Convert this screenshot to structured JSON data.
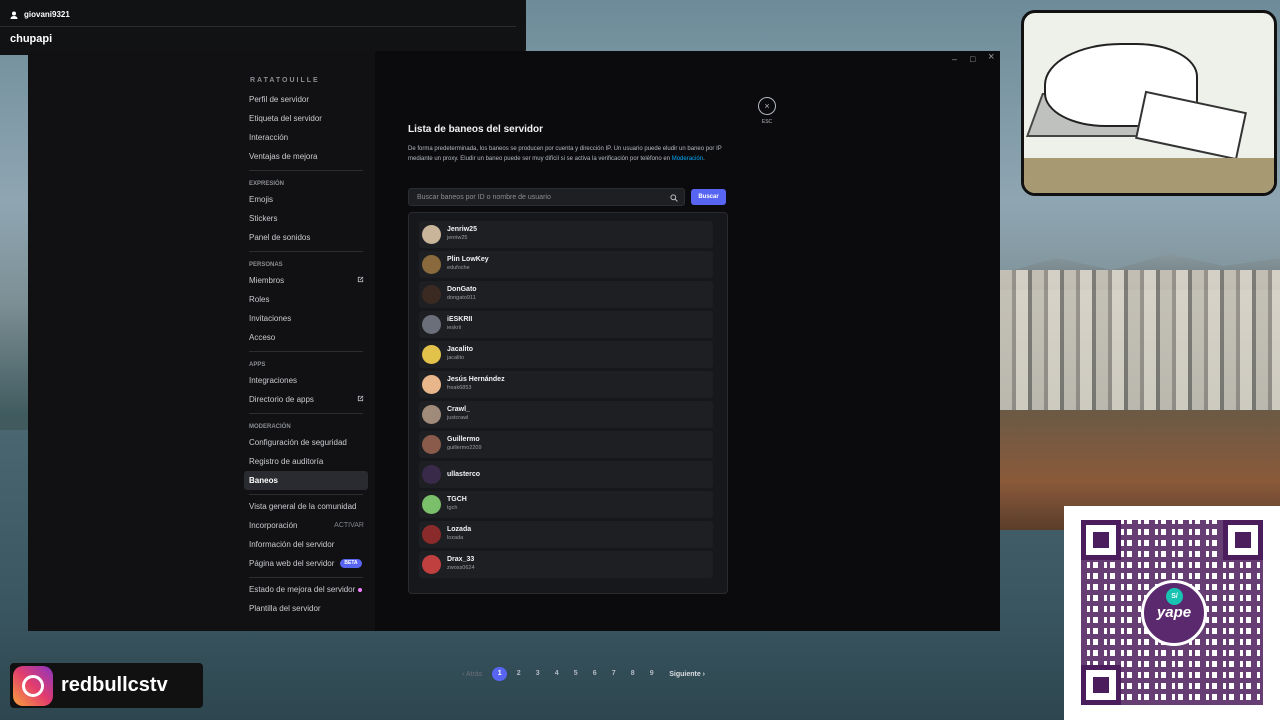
{
  "popup": {
    "username": "giovani9321",
    "name": "chupapi"
  },
  "window": {
    "min": "–",
    "max": "□",
    "close": "×"
  },
  "sidebar": {
    "server_name": "RATATOUILLE",
    "group1": [
      "Perfil de servidor",
      "Etiqueta del servidor",
      "Interacción",
      "Ventajas de mejora"
    ],
    "cat_expresion": "EXPRESIÓN",
    "group2": [
      "Emojis",
      "Stickers",
      "Panel de sonidos"
    ],
    "cat_personas": "PERSONAS",
    "group3": [
      "Miembros",
      "Roles",
      "Invitaciones",
      "Acceso"
    ],
    "cat_apps": "APPS",
    "group4": [
      "Integraciones",
      "Directorio de apps"
    ],
    "cat_moderacion": "MODERACIÓN",
    "group5": [
      "Configuración de seguridad",
      "Registro de auditoría",
      "Baneos"
    ],
    "group6": [
      "Vista general de la comunidad",
      "Incorporación",
      "Información del servidor",
      "Página web del servidor"
    ],
    "activar": "ACTIVAR",
    "beta": "BETA",
    "group7": [
      "Estado de mejora del servidor",
      "Plantilla del servidor"
    ]
  },
  "main": {
    "title": "Lista de baneos del servidor",
    "desc": "De forma predeterminada, los baneos se producen por cuenta y dirección IP. Un usuario puede eludir un baneo por IP mediante un proxy. Eludir un baneo puede ser muy difícil si se activa la verificación por teléfono en ",
    "desc_link": "Moderación",
    "desc_end": ".",
    "search_placeholder": "Buscar baneos por ID o nombre de usuario",
    "search_button": "Buscar",
    "esc_label": "ESC",
    "esc_icon": "×"
  },
  "bans": [
    {
      "name": "Jenriw25",
      "user": "jenriw25",
      "color": "#c9b59a"
    },
    {
      "name": "Plin LowKey",
      "user": "edufoche",
      "color": "#8a6a3c"
    },
    {
      "name": "DonGato",
      "user": "dongato911",
      "color": "#3a2a22"
    },
    {
      "name": "iESKRII",
      "user": "ieskrii",
      "color": "#6a6f7a"
    },
    {
      "name": "Jacalito",
      "user": "jacalito",
      "color": "#e2c24a"
    },
    {
      "name": "Jesús Hernández",
      "user": "freak6853",
      "color": "#e8b68a"
    },
    {
      "name": "Crawl_",
      "user": "justcrawl",
      "color": "#a08a7a"
    },
    {
      "name": "Guillermo",
      "user": "guillermo2209",
      "color": "#8a5a4a"
    },
    {
      "name": "ullasterco",
      "user": "",
      "color": "#3a2a4a"
    },
    {
      "name": "TGCH",
      "user": "tgch",
      "color": "#7ac06a"
    },
    {
      "name": "Lozada",
      "user": "lozada",
      "color": "#8a2a2a"
    },
    {
      "name": "Drax_33",
      "user": "zwoss0624",
      "color": "#c04040"
    }
  ],
  "pagination": {
    "prev": "‹ Atrás",
    "pages": [
      "1",
      "2",
      "3",
      "4",
      "5",
      "6",
      "7",
      "8",
      "9"
    ],
    "current": "1",
    "next": "Siguiente ›"
  },
  "overlays": {
    "instagram": "redbullcstv",
    "yape": "yape",
    "yape_badge": "S/"
  }
}
